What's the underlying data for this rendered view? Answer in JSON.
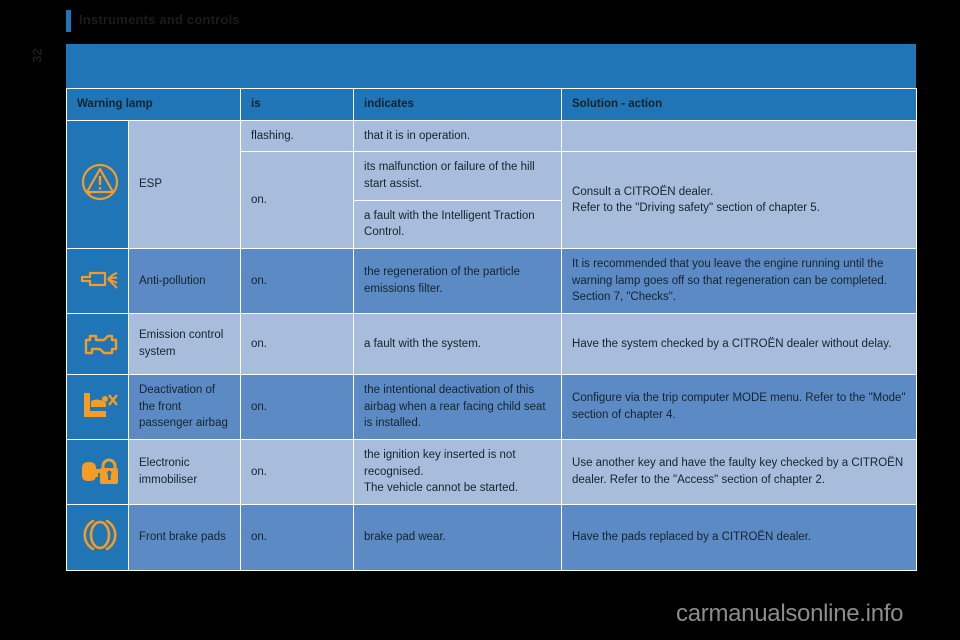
{
  "page": {
    "title": "Instruments and controls",
    "number": "32",
    "watermark": "carmanualsonline.info",
    "accent_color": "#1f75b5",
    "icon_color": "#f59c26",
    "row_light_color": "#a8bcdc",
    "row_mid_color": "#5c8ac4"
  },
  "table": {
    "headers": {
      "lamp": "Warning lamp",
      "is": "is",
      "indicates": "indicates",
      "solution": "Solution - action"
    },
    "rows": [
      {
        "icon": "esp-warning-triangle-icon",
        "name": "ESP",
        "shade": "light",
        "sub": [
          {
            "is": "flashing.",
            "indicates": "that it is in operation.",
            "solution": ""
          },
          {
            "is": "on.",
            "indicates": "its malfunction or failure of the hill start assist.",
            "solution": ""
          },
          {
            "is": "",
            "indicates": "a fault with the Intelligent Traction Control.",
            "solution": ""
          }
        ],
        "solution_line1": "Consult a CITROËN dealer.",
        "solution_line2": "Refer to the \"Driving safety\" section of chapter 5."
      },
      {
        "icon": "anti-pollution-exhaust-icon",
        "name": "Anti-pollution",
        "shade": "mid",
        "is": "on.",
        "indicates": "the regeneration of the particle emissions filter.",
        "solution": "It is recommended that you leave the engine running until the warning lamp goes off so that regeneration can be completed. Section 7, \"Checks\"."
      },
      {
        "icon": "emission-control-engine-icon",
        "name": "Emission control system",
        "shade": "light",
        "is": "on.",
        "indicates": "a fault with the system.",
        "solution": "Have the system checked by a CITROËN dealer without delay."
      },
      {
        "icon": "passenger-airbag-deactivation-icon",
        "name": "Deactivation of the front passenger airbag",
        "shade": "mid",
        "is": "on.",
        "indicates": "the intentional deactivation of this airbag when a rear facing child seat is installed.",
        "solution": "Configure via the trip computer MODE menu. Refer to the \"Mode\" section of chapter 4."
      },
      {
        "icon": "electronic-immobiliser-key-lock-icon",
        "name": "Electronic immobiliser",
        "shade": "light",
        "is": "on.",
        "indicates_line1": "the ignition key inserted is not recognised.",
        "indicates_line2": "The vehicle cannot be started.",
        "solution": "Use another key and have the faulty key checked by a CITROËN dealer. Refer to the \"Access\" section of chapter 2."
      },
      {
        "icon": "front-brake-pads-icon",
        "name": "Front brake pads",
        "shade": "mid",
        "is": "on.",
        "indicates": "brake pad wear.",
        "solution": "Have the pads replaced by a CITROËN dealer."
      }
    ]
  }
}
